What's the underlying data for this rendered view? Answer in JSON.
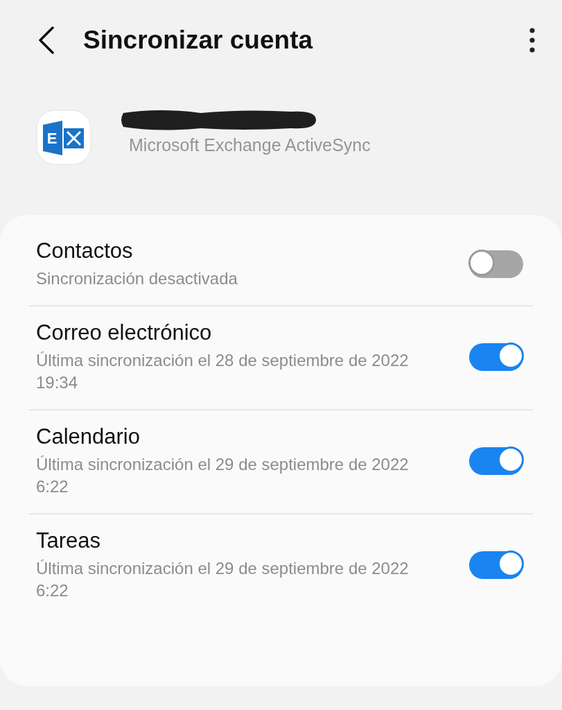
{
  "header": {
    "title": "Sincronizar cuenta"
  },
  "account": {
    "logo_letter": "E",
    "type": "Microsoft Exchange ActiveSync"
  },
  "items": [
    {
      "title": "Contactos",
      "subtitle": "Sincronización desactivada",
      "on": false
    },
    {
      "title": "Correo electrónico",
      "subtitle": "Última sincronización el 28 de septiembre de 2022 19:34",
      "on": true
    },
    {
      "title": "Calendario",
      "subtitle": "Última sincronización el 29 de septiembre de 2022 6:22",
      "on": true
    },
    {
      "title": "Tareas",
      "subtitle": "Última sincronización el 29 de septiembre de 2022 6:22",
      "on": true
    }
  ]
}
